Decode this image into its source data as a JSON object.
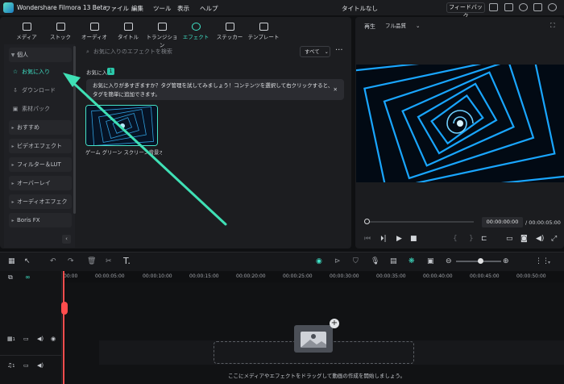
{
  "titlebar": {
    "app": "Wondershare Filmora 13 Beta",
    "menus": [
      "ファイル",
      "編集",
      "ツール",
      "表示",
      "ヘルプ"
    ],
    "project": "タイトルなし",
    "feedback": "フィードバック"
  },
  "tabs": [
    {
      "label": "メディア"
    },
    {
      "label": "ストック"
    },
    {
      "label": "オーディオ"
    },
    {
      "label": "タイトル"
    },
    {
      "label": "トランジション"
    },
    {
      "label": "エフェクト",
      "active": true
    },
    {
      "label": "ステッカー"
    },
    {
      "label": "テンプレート"
    }
  ],
  "sidebar": {
    "personal": "個人",
    "favorites": "お気に入り",
    "download": "ダウンロード",
    "material_pack": "素材パック",
    "categories": [
      "おすすめ",
      "ビデオエフェクト",
      "フィルター＆LUT",
      "オーバーレイ",
      "オーディオエフェクト",
      "Boris FX"
    ]
  },
  "search": {
    "placeholder": "お気に入りのエフェクトを検索",
    "filter": "すべて"
  },
  "favorites": {
    "label": "お気に入り",
    "count": "1",
    "notice": "お気に入りが多すぎますか？タグ管理を試してみましょう！コンテンツを選択して右クリックすると、タグを簡単に追加できます。",
    "item": "ゲーム グリーン スクリーン背景オーバーレイ"
  },
  "player": {
    "label": "再生",
    "quality": "フル品質",
    "current": "00:00:00:00",
    "total": "00:00:05:00"
  },
  "ruler": [
    "00:00",
    "00:00:05:00",
    "00:00:10:00",
    "00:00:15:00",
    "00:00:20:00",
    "00:00:25:00",
    "00:00:30:00",
    "00:00:35:00",
    "00:00:40:00",
    "00:00:45:00",
    "00:00:50:00"
  ],
  "tracks": {
    "video": "1",
    "audio": "1"
  },
  "drop_hint": "ここにメディアやエフェクトをドラッグして動画の作成を開始しましょう。",
  "colors": {
    "accent": "#3fe0c5",
    "playhead": "#ff4d4d"
  }
}
